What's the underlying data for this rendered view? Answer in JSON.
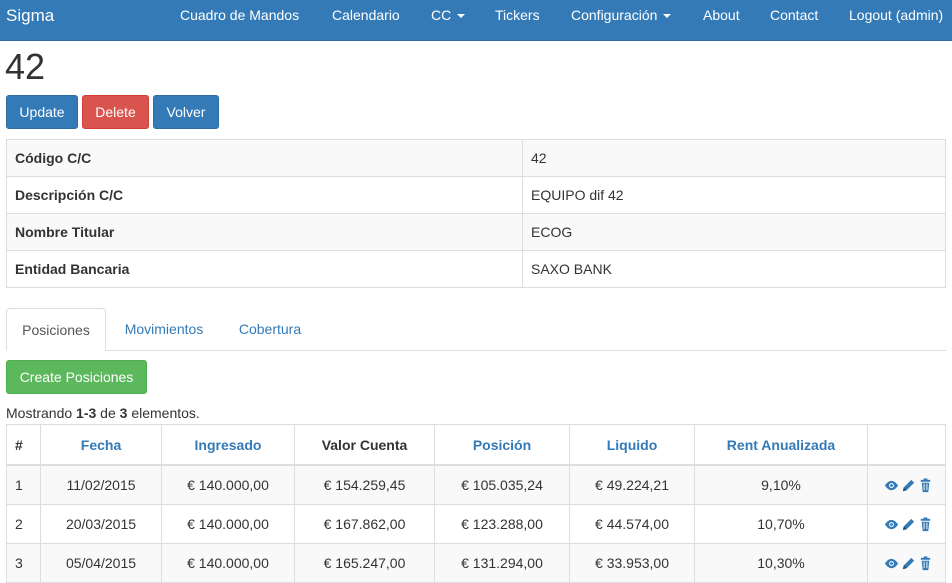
{
  "navbar": {
    "brand": "Sigma",
    "items": [
      {
        "label": "Cuadro de Mandos"
      },
      {
        "label": "Calendario"
      },
      {
        "label": "CC"
      },
      {
        "label": "Tickers"
      },
      {
        "label": "Configuración"
      },
      {
        "label": "About"
      },
      {
        "label": "Contact"
      },
      {
        "label": "Logout (admin)"
      }
    ]
  },
  "page": {
    "title": "42"
  },
  "buttons": {
    "update": "Update",
    "delete": "Delete",
    "back": "Volver",
    "create": "Create Posiciones"
  },
  "detail": [
    {
      "label": "Código C/C",
      "value": "42"
    },
    {
      "label": "Descripción C/C",
      "value": "EQUIPO dif 42"
    },
    {
      "label": "Nombre Titular",
      "value": "ECOG"
    },
    {
      "label": "Entidad Bancaria",
      "value": "SAXO BANK"
    }
  ],
  "tabs": [
    {
      "label": "Posiciones",
      "active": true
    },
    {
      "label": "Movimientos",
      "active": false
    },
    {
      "label": "Cobertura",
      "active": false
    }
  ],
  "summary": {
    "prefix": "Mostrando ",
    "range": "1-3",
    "middle": " de ",
    "total": "3",
    "suffix": " elementos."
  },
  "table": {
    "headers": [
      "#",
      "Fecha",
      "Ingresado",
      "Valor Cuenta",
      "Posición",
      "Liquido",
      "Rent Anualizada",
      ""
    ],
    "rows": [
      [
        "1",
        "11/02/2015",
        "€ 140.000,00",
        "€ 154.259,45",
        "€ 105.035,24",
        "€ 49.224,21",
        "9,10%"
      ],
      [
        "2",
        "20/03/2015",
        "€ 140.000,00",
        "€ 167.862,00",
        "€ 123.288,00",
        "€ 44.574,00",
        "10,70%"
      ],
      [
        "3",
        "05/04/2015",
        "€ 140.000,00",
        "€ 165.247,00",
        "€ 131.294,00",
        "€ 33.953,00",
        "10,30%"
      ]
    ]
  },
  "colors": {
    "primary": "#337ab7",
    "danger": "#d9534f",
    "success": "#5cb85c",
    "link": "#337ab7"
  }
}
